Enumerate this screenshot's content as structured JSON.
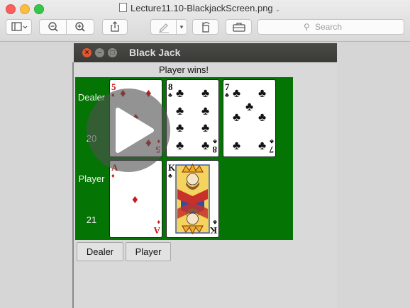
{
  "preview_window": {
    "file_title": "Lecture11.10-BlackjackScreen.png",
    "search_placeholder": "Search",
    "colors": {
      "close": "#fc605c",
      "minimize": "#fdbc40",
      "maximize": "#34c84a"
    },
    "toolbar_icons": [
      "sidebar-icon",
      "zoom-out-icon",
      "zoom-in-icon",
      "share-icon",
      "markup-pen-icon",
      "rotate-icon",
      "toolbox-icon",
      "search-icon"
    ]
  },
  "blackjack": {
    "window_title": "Black Jack",
    "status": "Player wins!",
    "felt_color": "#047404",
    "dealer": {
      "label": "Dealer",
      "score": "20",
      "cards": [
        {
          "rank": "5",
          "suit": "♦",
          "color": "#c81818"
        },
        {
          "rank": "8",
          "suit": "♣",
          "color": "#111111"
        },
        {
          "rank": "7",
          "suit": "♣",
          "color": "#111111"
        }
      ]
    },
    "player": {
      "label": "Player",
      "score": "21",
      "cards": [
        {
          "rank": "A",
          "suit": "♦",
          "color": "#c81818"
        },
        {
          "rank": "K",
          "suit": "♣",
          "color": "#111111"
        }
      ]
    },
    "buttons": {
      "dealer": "Dealer",
      "player": "Player"
    }
  }
}
